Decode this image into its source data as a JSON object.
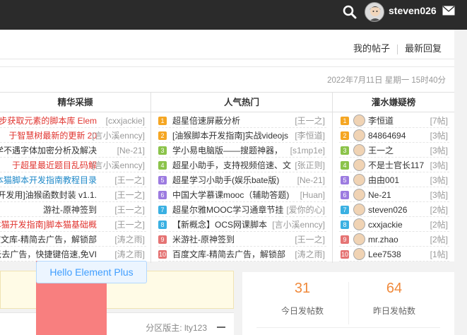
{
  "topbar": {
    "username": "steven026",
    "icons": [
      "search-icon",
      "user-avatar",
      "mail-icon"
    ]
  },
  "nav": {
    "my_posts": "我的帖子",
    "latest_replies": "最新回复"
  },
  "board": {
    "datetime": "2022年7月11日 星期一 15时40分",
    "columns": {
      "featured": "精华采撷",
      "hot": "人气热门",
      "top_posters": "灌水嫌疑榜"
    },
    "featured": [
      {
        "title": "步获取元素的脚本库 Elem",
        "author": "[cxxjackie]",
        "color": "#e0342f"
      },
      {
        "title": "于智慧树最新的更新 20",
        "author": "[言小溪enncy]",
        "color": "#e0342f"
      },
      {
        "title": "星学不遇字体加密分析及解决",
        "author": "[Ne-21]",
        "color": "#333333"
      },
      {
        "title": "于超星最近题目乱码解",
        "author": "[言小溪enncy]",
        "color": "#e0342f"
      },
      {
        "title": "本猫脚本开发指南教程目录",
        "author": "[王一之]",
        "color": "#1e88c8"
      },
      {
        "title": "本开发用]油猴函数封装 v1.1.",
        "author": "[王一之]",
        "color": "#333333"
      },
      {
        "title": "游社-原神签到",
        "author": "[王一之]",
        "color": "#333333"
      },
      {
        "title": "本猫开发指南]脚本猫基础概",
        "author": "[王一之]",
        "color": "#e0342f"
      },
      {
        "title": "度文库-精简去广告，解锁部",
        "author": "[涛之雨]",
        "color": "#333333"
      },
      {
        "title": "度云去广告，快捷键倍速,免VI",
        "author": "[涛之雨]",
        "color": "#333333"
      }
    ],
    "hot": [
      {
        "n": "1",
        "title": "超星倍速屏蔽分析",
        "author": "[王一之]",
        "c": "#f5a623"
      },
      {
        "n": "2",
        "title": "[油猴脚本开发指南]实战videojs",
        "author": "[李恒道]",
        "c": "#f5a623"
      },
      {
        "n": "3",
        "title": "学小易电脑版——搜题神器，",
        "author": "[s1mp1e]",
        "c": "#8bc34a"
      },
      {
        "n": "4",
        "title": "超星小助手，支持视频倍速、文",
        "author": "[张正则]",
        "c": "#8bc34a"
      },
      {
        "n": "5",
        "title": "超星学习小助手(娱乐bate版)",
        "author": "[Ne-21]",
        "c": "#9c7be0"
      },
      {
        "n": "6",
        "title": "中国大学慕课mooc（辅助答题)",
        "author": "[Huan]",
        "c": "#9c7be0"
      },
      {
        "n": "7",
        "title": "超星尔雅MOOC学习通章节挂",
        "author": "[爱你的心]",
        "c": "#3ab0e2"
      },
      {
        "n": "8",
        "title": "【新概念】OCS网课脚本",
        "author": "[言小溪enncy]",
        "c": "#3ab0e2"
      },
      {
        "n": "9",
        "title": "米游社-原神签到",
        "author": "[王一之]",
        "c": "#e57373"
      },
      {
        "n": "10",
        "title": "百度文库-精简去广告，解锁部",
        "author": "[涛之雨]",
        "c": "#e57373"
      }
    ],
    "top_posters": [
      {
        "n": "1",
        "name": "李恒道",
        "count": "[7帖]",
        "c": "#f5a623"
      },
      {
        "n": "2",
        "name": "84864694",
        "count": "[3帖]",
        "c": "#f5a623"
      },
      {
        "n": "3",
        "name": "王一之",
        "count": "[3帖]",
        "c": "#8bc34a"
      },
      {
        "n": "4",
        "name": "不是士官长117",
        "count": "[3帖]",
        "c": "#8bc34a"
      },
      {
        "n": "5",
        "name": "由由001",
        "count": "[3帖]",
        "c": "#9c7be0"
      },
      {
        "n": "6",
        "name": "Ne-21",
        "count": "[3帖]",
        "c": "#9c7be0"
      },
      {
        "n": "7",
        "name": "steven026",
        "count": "[2帖]",
        "c": "#3ab0e2"
      },
      {
        "n": "8",
        "name": "cxxjackie",
        "count": "[2帖]",
        "c": "#3ab0e2"
      },
      {
        "n": "9",
        "name": "mr.zhao",
        "count": "[2帖]",
        "c": "#e57373"
      },
      {
        "n": "10",
        "name": "Lee7538",
        "count": "[1帖]",
        "c": "#e57373"
      }
    ]
  },
  "tooltip": "Hello Element Plus",
  "moderator": "分区版主: lty123",
  "stats": {
    "today_value": "31",
    "today_label": "今日发帖数",
    "yesterday_value": "64",
    "yesterday_label": "昨日发帖数"
  }
}
